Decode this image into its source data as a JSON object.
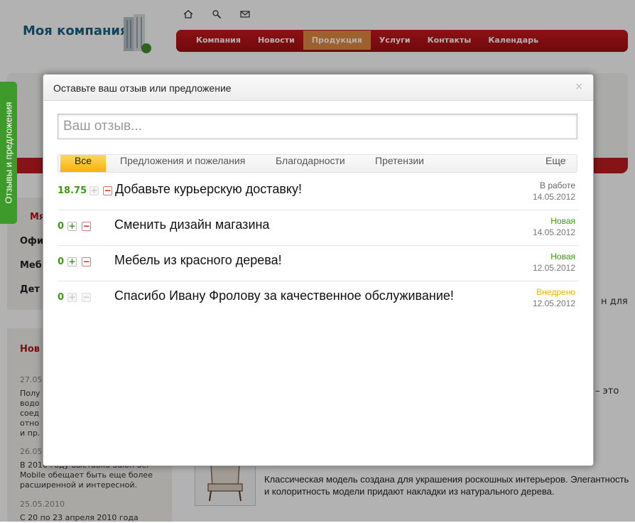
{
  "site": {
    "logo": "Моя компания",
    "menu": [
      "Компания",
      "Новости",
      "Продукция",
      "Услуги",
      "Контакты",
      "Календарь"
    ],
    "menu_active": "Продукция",
    "sidebar_items": [
      "Мя",
      "Офи",
      "Меб",
      "Дет"
    ],
    "news_heading": "Нов",
    "news": [
      {
        "date": "27.05.",
        "lines": [
          "Полу",
          "водо",
          "соед",
          "отно",
          "и пр."
        ]
      },
      {
        "date": "26.05.",
        "lines": [
          "В 2010 году выставка Salon del",
          "Mobile обещает быть еще более",
          "расширенной и интересной."
        ]
      },
      {
        "date": "25.05.2010",
        "lines": [
          "С 20 по 23 апреля 2010 года"
        ]
      }
    ],
    "right_fragments": [
      "н для",
      "– это"
    ],
    "product_text": "Классическая модель создана для украшения роскошных интерьеров. Элегантность и колоритность модели придают накладки из натурального дерева.",
    "colors": {
      "menu": "#b51418",
      "menu_active": "#e38a3f",
      "logo": "#1c6282",
      "side_tab": "#3e9b2b"
    }
  },
  "side_tab": {
    "label": "Отзывы и предложения"
  },
  "modal": {
    "title": "Оставьте ваш отзыв или предложение",
    "close": "×",
    "search_placeholder": "Ваш отзыв...",
    "tabs": [
      "Все",
      "Предложения и пожелания",
      "Благодарности",
      "Претензии",
      "Еще"
    ],
    "active_tab": "Все",
    "items": [
      {
        "score": "18.75",
        "title": "Добавьте курьерскую доставку!",
        "status": "В работе",
        "status_color": "#666666",
        "date": "14.05.2012",
        "plus_enabled": false,
        "minus_enabled": true
      },
      {
        "score": "0",
        "title": "Сменить дизайн магазина",
        "status": "Новая",
        "status_color": "#3c9a12",
        "date": "14.05.2012",
        "plus_enabled": true,
        "minus_enabled": true
      },
      {
        "score": "0",
        "title": "Мебель из красного дерева!",
        "status": "Новая",
        "status_color": "#3c9a12",
        "date": "12.05.2012",
        "plus_enabled": true,
        "minus_enabled": true
      },
      {
        "score": "0",
        "title": "Спасибо Ивану Фролову за качественное обслуживание!",
        "status": "Внедрено",
        "status_color": "#e8b400",
        "date": "12.05.2012",
        "plus_enabled": false,
        "minus_enabled": false
      }
    ],
    "vote_plus": "+",
    "vote_minus": "−"
  }
}
